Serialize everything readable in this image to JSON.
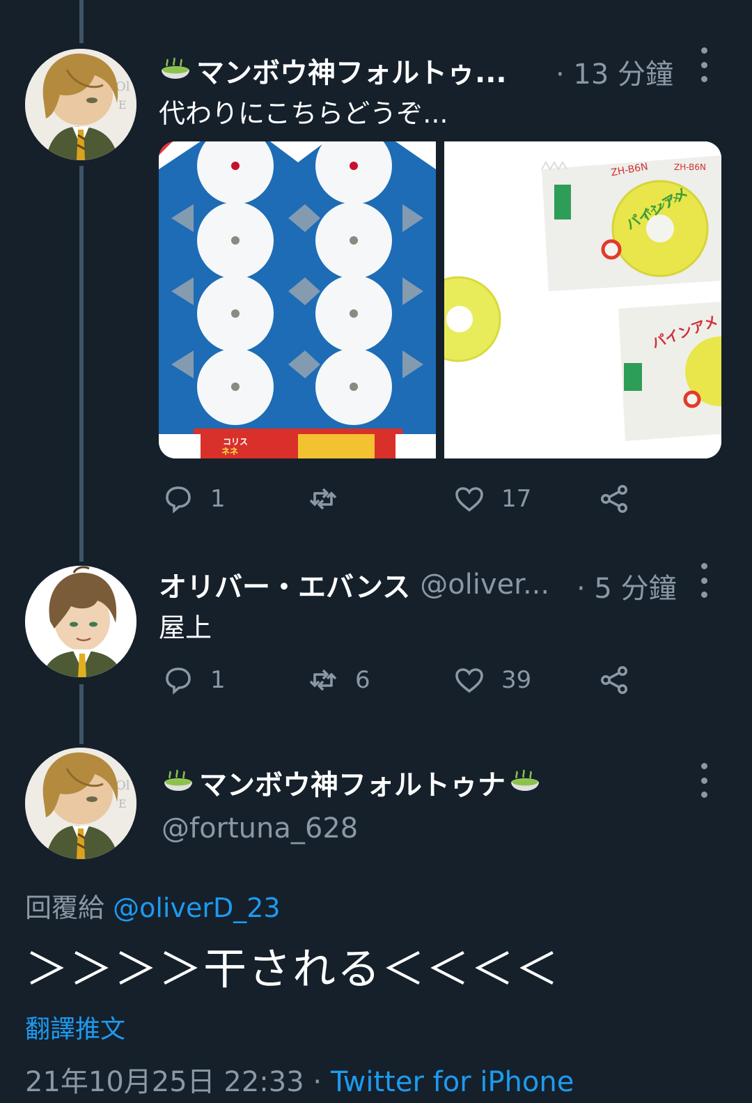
{
  "tweet1": {
    "display_name": "マンボウ神フォルトゥ...",
    "time": "· 13 分鐘",
    "text": "代わりにこちらどうぞ...",
    "replies": "1",
    "retweets": "",
    "likes": "17"
  },
  "tweet2": {
    "display_name": "オリバー・エバンス",
    "handle": "@oliver...",
    "time": "· 5 分鐘",
    "text": "屋上",
    "replies": "1",
    "retweets": "6",
    "likes": "39"
  },
  "main_tweet": {
    "display_name": "マンボウ神フォルトゥナ",
    "handle": "@fortuna_628",
    "reply_prefix": "回覆給",
    "reply_handle": "@oliverD_23",
    "text": "＞＞＞＞干される＜＜＜＜",
    "translate": "翻譯推文",
    "timestamp": "21年10月25日 22:33 · ",
    "source": "Twitter for iPhone"
  },
  "media_labels": {
    "left_pack": "コリス",
    "left_pack2": "ネネ",
    "right_label": "パインアメ",
    "right_code": "ZH-B6N"
  },
  "colors": {
    "background": "#15202b",
    "secondary_text": "#8b98a5",
    "link": "#1d9bf0",
    "thread_line": "#3d5466"
  }
}
